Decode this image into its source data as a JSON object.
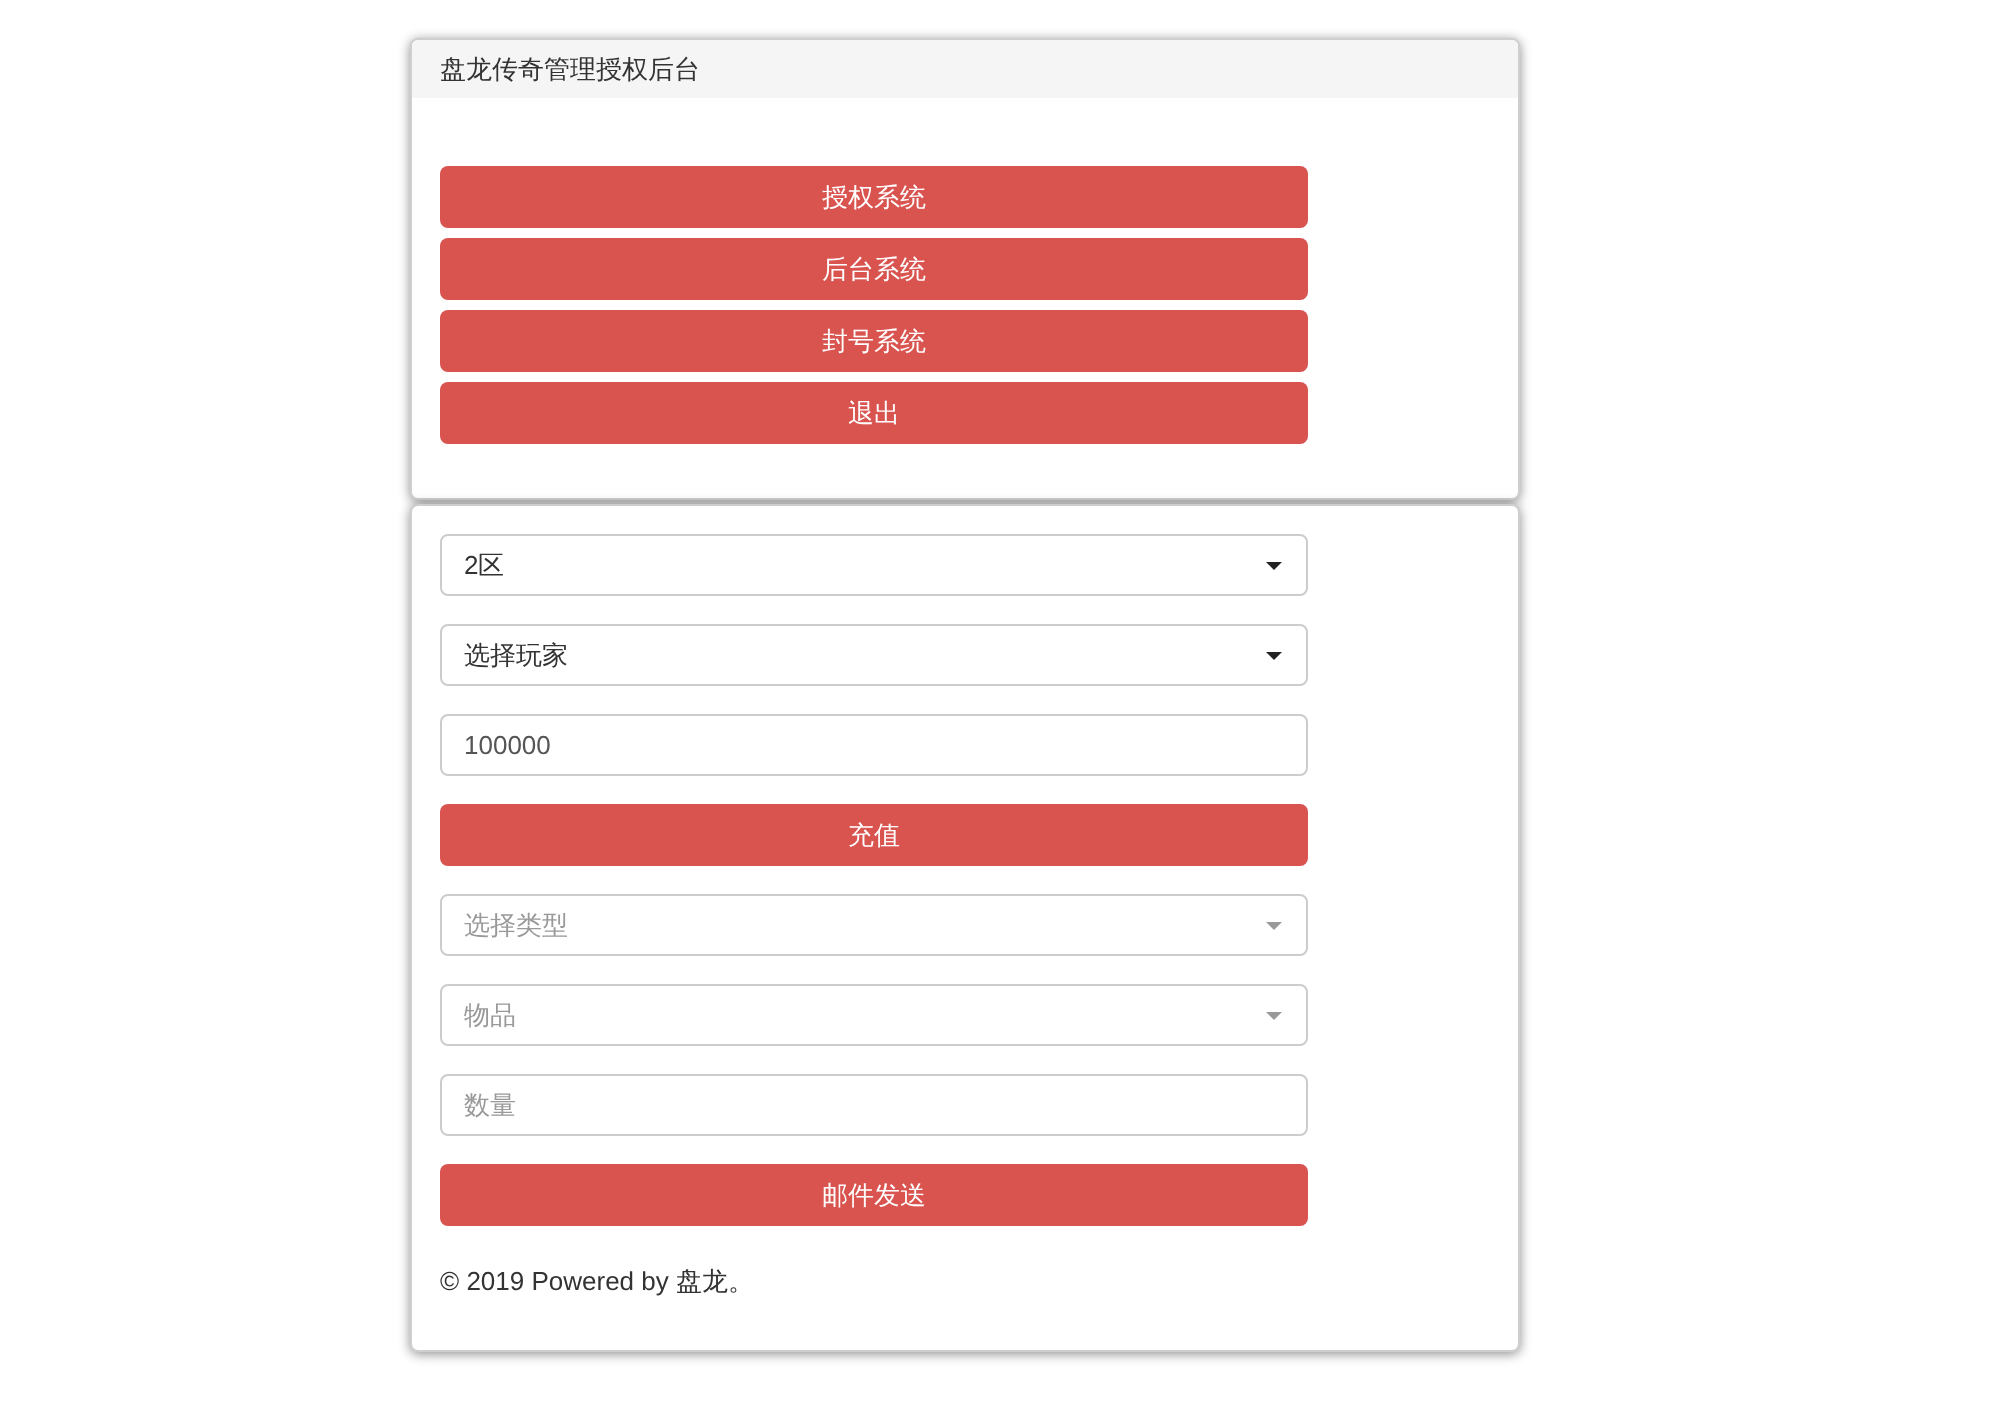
{
  "top_panel": {
    "title": "盘龙传奇管理授权后台",
    "buttons": [
      {
        "label": "授权系统"
      },
      {
        "label": "后台系统"
      },
      {
        "label": "封号系统"
      },
      {
        "label": "退出"
      }
    ]
  },
  "form": {
    "items": [
      {
        "kind": "select",
        "value": "2区"
      },
      {
        "kind": "select",
        "value": "选择玩家"
      },
      {
        "kind": "input",
        "value": "100000"
      },
      {
        "kind": "button",
        "label": "充值"
      },
      {
        "kind": "select",
        "placeholder": "选择类型"
      },
      {
        "kind": "select",
        "placeholder": "物品"
      },
      {
        "kind": "input",
        "placeholder": "数量"
      },
      {
        "kind": "button",
        "label": "邮件发送"
      }
    ],
    "footer": "© 2019 Powered by 盘龙。"
  }
}
